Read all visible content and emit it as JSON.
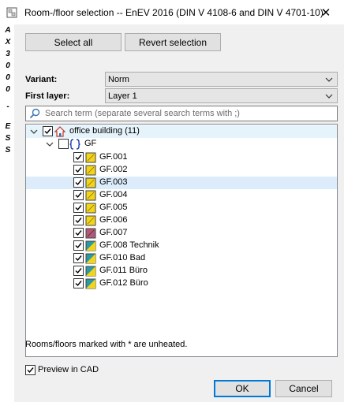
{
  "window": {
    "title": "Room-/floor selection -- EnEV 2016 (DIN V 4108-6 and DIN V 4701-10)",
    "close_symbol": "✕"
  },
  "side_label": [
    "A",
    "X",
    "3",
    "0",
    "0",
    "0",
    "-",
    "E",
    "S",
    "S"
  ],
  "toolbar": {
    "select_all_label": "Select all",
    "revert_label": "Revert selection"
  },
  "variant": {
    "label": "Variant:",
    "value": "Norm"
  },
  "first_layer": {
    "label": "First layer:",
    "value": "Layer 1"
  },
  "search": {
    "placeholder": "Search term (separate several search terms with ;)"
  },
  "tree": {
    "root": {
      "label": "office building (11)",
      "icon": "house-icon",
      "checked": true
    },
    "floor": {
      "label": "GF",
      "icon": "floor-bracket-icon",
      "checked": false
    },
    "rooms": [
      {
        "label": "GF.001",
        "icon": "room-yellow-icon",
        "checked": true
      },
      {
        "label": "GF.002",
        "icon": "room-yellow-icon",
        "checked": true
      },
      {
        "label": "GF.003",
        "icon": "room-yellow-icon",
        "checked": true
      },
      {
        "label": "GF.004",
        "icon": "room-yellow-icon",
        "checked": true
      },
      {
        "label": "GF.005",
        "icon": "room-yellow-icon",
        "checked": true
      },
      {
        "label": "GF.006",
        "icon": "room-yellow-icon",
        "checked": true
      },
      {
        "label": "GF.007",
        "icon": "room-red-icon",
        "checked": true
      },
      {
        "label": "GF.008 Technik",
        "icon": "room-green-icon",
        "checked": true
      },
      {
        "label": "GF.010 Bad",
        "icon": "room-green-icon",
        "checked": true
      },
      {
        "label": "GF.011 Büro",
        "icon": "room-green-icon",
        "checked": true
      },
      {
        "label": "GF.012 Büro",
        "icon": "room-green-icon",
        "checked": true
      }
    ]
  },
  "note": "Rooms/floors marked with * are unheated.",
  "preview": {
    "label": "Preview in CAD",
    "checked": true
  },
  "footer": {
    "ok_label": "OK",
    "cancel_label": "Cancel"
  }
}
